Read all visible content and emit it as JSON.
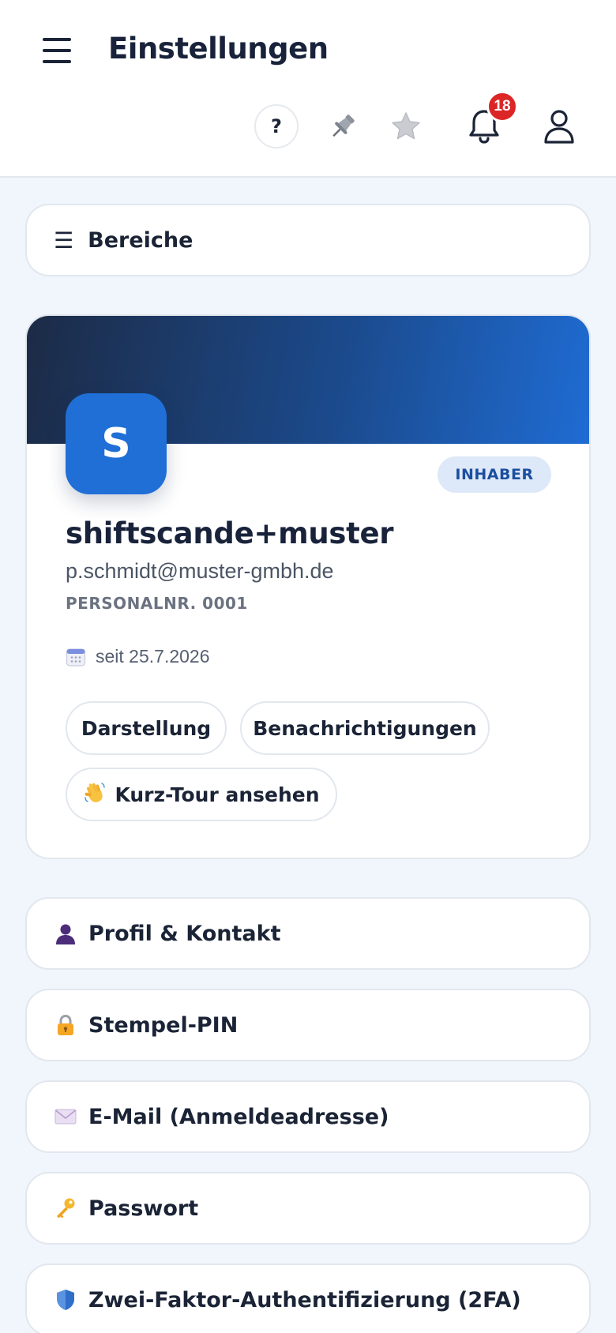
{
  "header": {
    "title": "Einstellungen",
    "help_label": "?",
    "notifications_count": "18"
  },
  "bereiche": {
    "label": "Bereiche"
  },
  "profile": {
    "avatar_initial": "S",
    "role": "INHABER",
    "name": "shiftscande+muster",
    "email": "p.schmidt@muster-gmbh.de",
    "personal_nr": "PERSONALNR. 0001",
    "since": "seit 25.7.2026",
    "actions": {
      "appearance": "Darstellung",
      "notifications": "Benachrichtigungen",
      "tour": "Kurz-Tour ansehen"
    }
  },
  "sections": [
    {
      "label": "Profil & Kontakt",
      "icon": "person-icon"
    },
    {
      "label": "Stempel-PIN",
      "icon": "lock-icon"
    },
    {
      "label": "E-Mail (Anmeldeadresse)",
      "icon": "envelope-icon"
    },
    {
      "label": "Passwort",
      "icon": "key-icon"
    },
    {
      "label": "Zwei-Faktor-Authentifizierung (2FA)",
      "icon": "shield-icon"
    }
  ],
  "colors": {
    "accent": "#1f6fd6",
    "badge": "#dc2626",
    "background": "#f1f6fd",
    "banner_start": "#1c2b46",
    "banner_end": "#1f6cd4"
  }
}
